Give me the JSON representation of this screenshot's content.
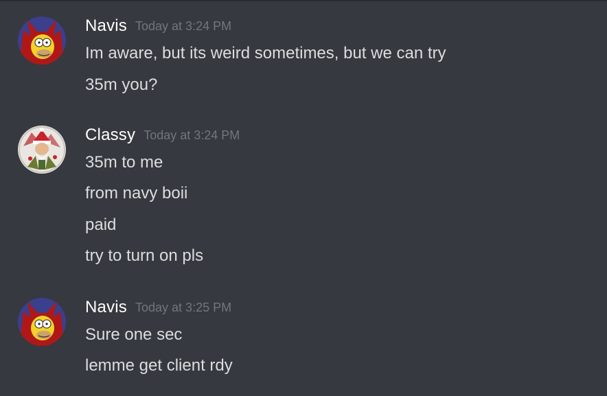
{
  "messages": [
    {
      "author": "Navis",
      "avatar_icon": "homer-devil-avatar-icon",
      "timestamp": "Today at 3:24 PM",
      "lines": [
        "Im aware, but its weird sometimes, but we can try",
        "35m you?"
      ]
    },
    {
      "author": "Classy",
      "avatar_icon": "santa-avatar-icon",
      "timestamp": "Today at 3:24 PM",
      "lines": [
        "35m to me",
        "from navy boii",
        "paid",
        "try to turn on pls"
      ]
    },
    {
      "author": "Navis",
      "avatar_icon": "homer-devil-avatar-icon",
      "timestamp": "Today at 3:25 PM",
      "lines": [
        "Sure one sec",
        "lemme get client rdy"
      ]
    }
  ],
  "colors": {
    "background": "#36393f",
    "username": "#ffffff",
    "timestamp": "#72767d",
    "message_text": "#dcddde"
  }
}
